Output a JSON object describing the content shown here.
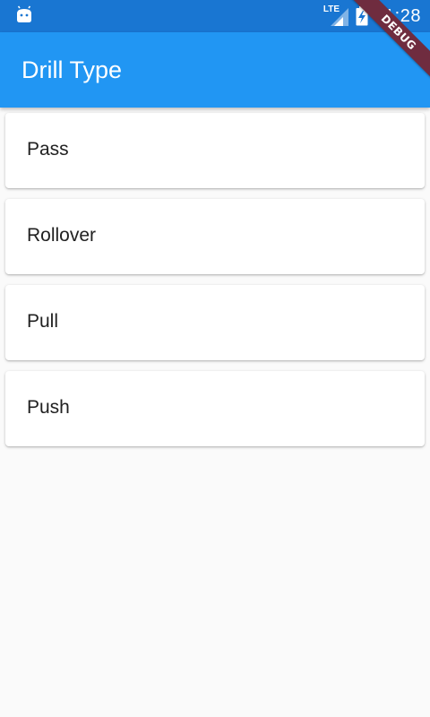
{
  "status_bar": {
    "network": "LTE",
    "time": "11:28",
    "icons": [
      "android-icon",
      "lte-signal-icon",
      "battery-charging-icon"
    ]
  },
  "app_bar": {
    "title": "Drill Type",
    "color": "#2196f3"
  },
  "debug_banner": {
    "label": "DEBUG"
  },
  "drill_types": [
    {
      "label": "Pass"
    },
    {
      "label": "Rollover"
    },
    {
      "label": "Pull"
    },
    {
      "label": "Push"
    }
  ]
}
